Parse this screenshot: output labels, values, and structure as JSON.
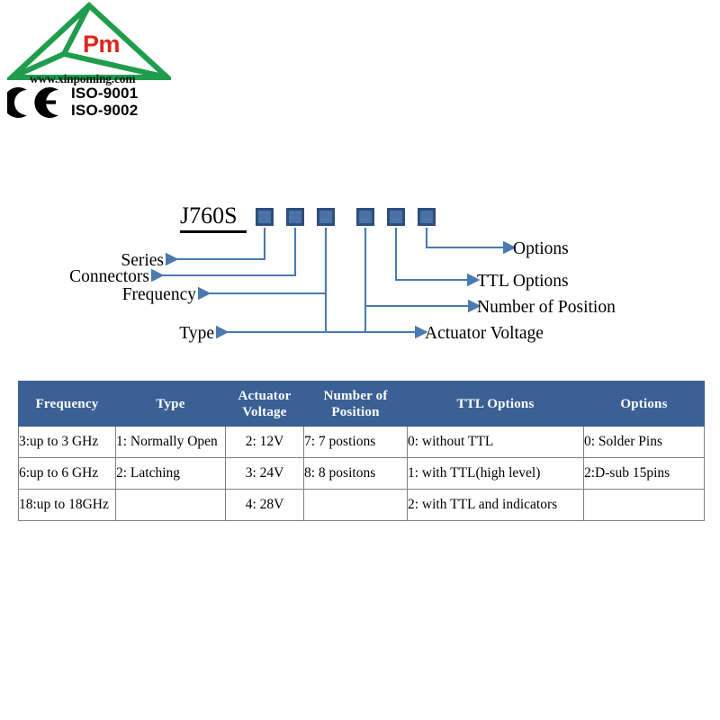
{
  "logo": {
    "brand_text": "Pm",
    "brand_color": "#e1251b",
    "triangle_color": "#1f9d4d",
    "website": "www.xinpoming.com",
    "ce_mark_label": "CE",
    "certifications": [
      "ISO-9001",
      "ISO-9002"
    ]
  },
  "diagram": {
    "part_code": "J760S",
    "box_count": 6,
    "box_fill": "#4a72a8",
    "box_border": "#2e4d7b",
    "arrow_color": "#4a7ab0",
    "left_labels": [
      "Series",
      "Connectors",
      "Frequency",
      "Type"
    ],
    "right_labels": [
      "Options",
      "TTL Options",
      "Number of Position",
      "Actuator Voltage"
    ]
  },
  "table": {
    "header_bg": "#3a6095",
    "header_fg": "#ffffff",
    "columns": [
      "Frequency",
      "Type",
      "Actuator\nVoltage",
      "Number of\nPosition",
      "TTL  Options",
      "Options"
    ],
    "columns_flat": [
      "Frequency",
      "Type",
      "Actuator Voltage",
      "Number of Position",
      "TTL  Options",
      "Options"
    ],
    "header_line1": [
      "Frequency",
      "Type",
      "Actuator",
      "Number of",
      "TTL  Options",
      "Options"
    ],
    "header_line2": [
      "",
      "",
      "Voltage",
      "Position",
      "",
      ""
    ],
    "rows": [
      {
        "frequency": "3:up to 3 GHz",
        "type": "1: Normally Open",
        "actuator_voltage": "2: 12V",
        "number_of_position": "7: 7 postions",
        "ttl_options": "0: without TTL",
        "options": "0: Solder Pins"
      },
      {
        "frequency": "6:up to 6 GHz",
        "type": "2: Latching",
        "actuator_voltage": "3: 24V",
        "number_of_position": "8: 8 positons",
        "ttl_options": "1: with TTL(high level)",
        "options": "2:D-sub 15pins"
      },
      {
        "frequency": "18:up to 18GHz",
        "type": "",
        "actuator_voltage": "4: 28V",
        "number_of_position": "",
        "ttl_options": "2: with TTL and indicators",
        "options": ""
      }
    ]
  }
}
